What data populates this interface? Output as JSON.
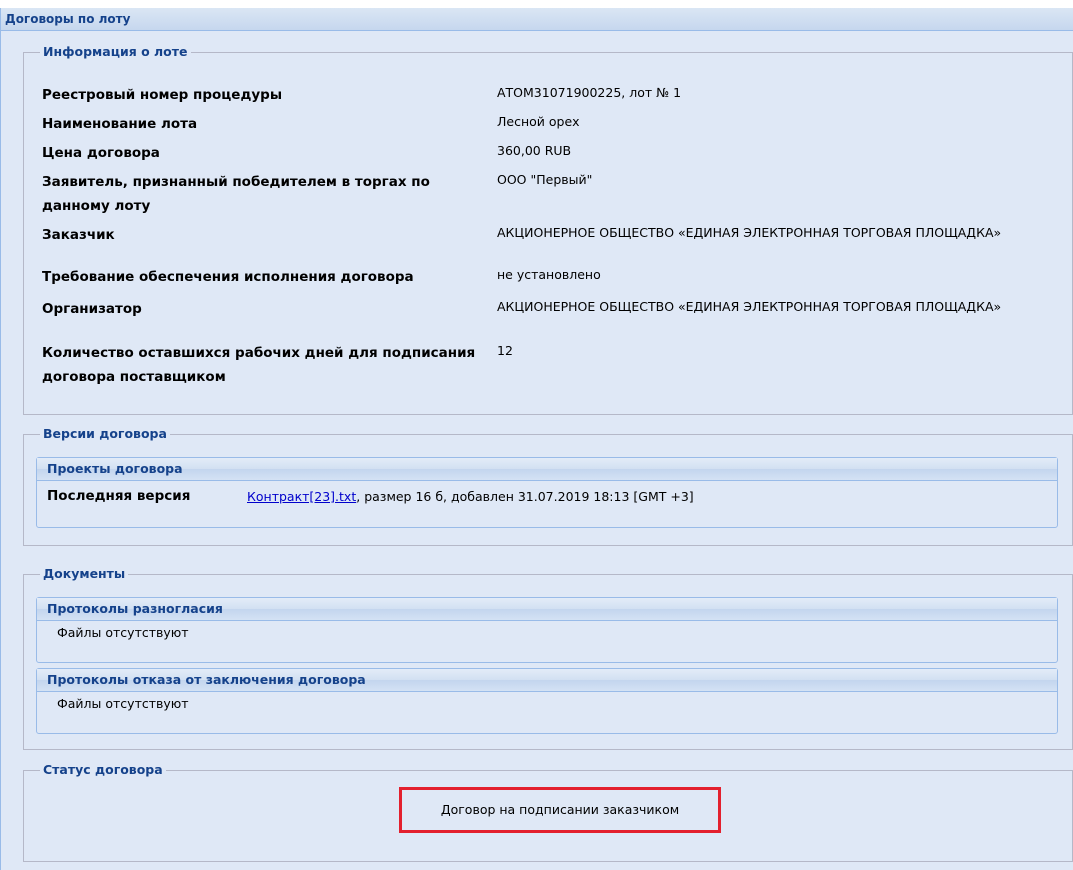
{
  "panel": {
    "title": "Договоры по лоту"
  },
  "lot_info": {
    "legend": "Информация о лоте",
    "rows": [
      {
        "label": "Реестровый номер процедуры",
        "value": "АТОМ31071900225, лот № 1"
      },
      {
        "label": "Наименование лота",
        "value": "Лесной орех"
      },
      {
        "label": "Цена договора",
        "value": "360,00 RUB"
      },
      {
        "label": "Заявитель, признанный победителем в торгах по данному лоту",
        "value": "ООО \"Первый\""
      },
      {
        "label": "Заказчик",
        "value": "АКЦИОНЕРНОЕ ОБЩЕСТВО «ЕДИНАЯ ЭЛЕКТРОННАЯ ТОРГОВАЯ ПЛОЩАДКА»"
      },
      {
        "label": "Требование обеспечения исполнения договора",
        "value": "не установлено"
      },
      {
        "label": "Организатор",
        "value": "АКЦИОНЕРНОЕ ОБЩЕСТВО «ЕДИНАЯ ЭЛЕКТРОННАЯ ТОРГОВАЯ ПЛОЩАДКА»"
      },
      {
        "label": "Количество оставшихся рабочих дней для подписания договора поставщиком",
        "value": "12"
      }
    ]
  },
  "versions": {
    "legend": "Версии договора",
    "projects": {
      "title": "Проекты договора",
      "latest_label": "Последняя версия",
      "file_name": "Контракт[23].txt",
      "file_info": ", размер 16 б, добавлен 31.07.2019 18:13 [GMT +3]"
    }
  },
  "documents": {
    "legend": "Документы",
    "disagreement": {
      "title": "Протоколы разногласия",
      "empty_text": "Файлы отсутствуют"
    },
    "refusal": {
      "title": "Протоколы отказа от заключения договора",
      "empty_text": "Файлы отсутствуют"
    }
  },
  "status": {
    "legend": "Статус договора",
    "text": "Договор на подписании заказчиком",
    "highlight_color": "#e3202e"
  }
}
